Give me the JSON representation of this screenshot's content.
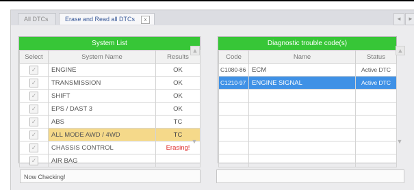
{
  "tabs": [
    {
      "label": "All DTCs"
    },
    {
      "label": "Erase and Read all DTCs",
      "close": "x"
    }
  ],
  "nav": {
    "prev": "◄",
    "next": "►"
  },
  "system_list": {
    "title": "System List",
    "columns": [
      "Select",
      "System Name",
      "Results"
    ],
    "rows": [
      {
        "name": "ENGINE",
        "result": "OK"
      },
      {
        "name": "TRANSMISSION",
        "result": "OK"
      },
      {
        "name": "SHIFT",
        "result": "OK"
      },
      {
        "name": "EPS / DAST 3",
        "result": "OK"
      },
      {
        "name": "ABS",
        "result": "TC"
      },
      {
        "name": "ALL MODE AWD / 4WD",
        "result": "TC"
      },
      {
        "name": "CHASSIS CONTROL",
        "result": "Erasing!"
      },
      {
        "name": "AIR BAG",
        "result": ""
      }
    ]
  },
  "dtc_list": {
    "title": "Diagnostic trouble code(s)",
    "columns": [
      "Code",
      "Name",
      "Status"
    ],
    "rows": [
      {
        "code": "C1080-86",
        "name": "ECM",
        "status": "Active DTC"
      },
      {
        "code": "C1210-97",
        "name": "ENGINE SIGNAL",
        "status": "Active DTC"
      },
      {
        "code": "",
        "name": "",
        "status": ""
      },
      {
        "code": "",
        "name": "",
        "status": ""
      },
      {
        "code": "",
        "name": "",
        "status": ""
      },
      {
        "code": "",
        "name": "",
        "status": ""
      },
      {
        "code": "",
        "name": "",
        "status": ""
      },
      {
        "code": "",
        "name": "",
        "status": ""
      }
    ]
  },
  "status_bar": {
    "left": "Now Checking!",
    "right": ""
  },
  "colors": {
    "header_green": "#37c637",
    "selected_blue": "#3f91e6",
    "highlight_yellow": "#f5d98a",
    "erasing_red": "#dd2a2a"
  }
}
